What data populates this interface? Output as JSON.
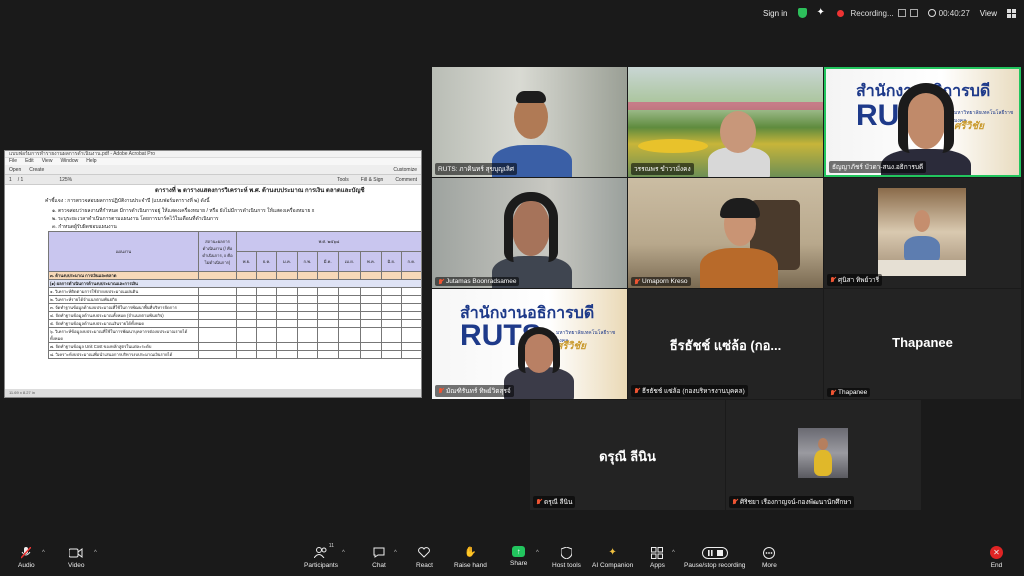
{
  "topbar": {
    "sign_in": "Sign in",
    "recording": "Recording...",
    "timer": "00:40:27",
    "view": "View"
  },
  "share": {
    "window_title": "แบบฟอร์มการทำรายงานผลการดำเนินงาน.pdf - Adobe Acrobat Pro",
    "menu": [
      "File",
      "Edit",
      "View",
      "Window",
      "Help"
    ],
    "toolbar1": [
      "Open",
      "Create"
    ],
    "customize": "Customize",
    "page_current": "1",
    "page_total": "/ 1",
    "zoom": "125%",
    "right_tabs": [
      "Tools",
      "Fill & Sign",
      "Comment"
    ],
    "heading": "ตารางที่ ๒ ตารางแสดงการวิเคราะห์ พ.ศ. ด้านงบประมาณ การเงิน ตลาดและบัญชี",
    "instructions": [
      "คำชี้แจง : การตรวจสอบผลการปฏิบัติงานประจำปี (แบบฟอร์มตารางที่ ๒) ดังนี้",
      "๑. ตรวจสอบว่าผลงานที่กำหนด มีการดำเนินการอยู่ ให้แสดงเครื่องหมาย / หรือ ยังไม่มีการดำเนินการ ให้แสดงเครื่องหมาย x",
      "๒. ระบุระยะเวลาดำเนินการตามแผนงาน โดยการมาร์คไว้ในเดือนที่ดำเนินการ",
      "๓. กำหนดผู้รับผิดชอบแผนงาน"
    ],
    "table": {
      "col_item": "แผนงาน",
      "col_status": "สถานะผลการดำเนินงาน (/ คือ ดำเนินการ, x คือ ไม่ดำเนินการ)",
      "col_year": "พ.ศ. ๒๕๖๘",
      "months": [
        "พ.ย.",
        "ธ.ค.",
        "ม.ค.",
        "ก.พ.",
        "มี.ค.",
        "เม.ย.",
        "พ.ค.",
        "มิ.ย.",
        "ก.ค."
      ],
      "section": "๓. ด้านงบประมาณ การเงินและตลาด",
      "subsection": "(๑) ผลการดำเนินการด้านงบประมาณและการเงิน",
      "rows": [
        "๑. วิเคราะห์ติดตามการใช้จ่ายงบประมาณแผ่นดิน",
        "๒. วิเคราะห์รายได้จำแนกตามพันธกิจ",
        "๓. จัดทำฐานข้อมูลด้านงบประมาณที่ใช้ในการพัฒนาพื้นที่บริหารจัดการ",
        "๔. จัดทำฐานข้อมูลด้านงบประมาณทั้งหมด (จำแนกตามพันธกิจ)",
        "๕. จัดทำฐานข้อมูลด้านงบประมาณเงินรายได้ทั้งหมด",
        "๖. วิเคราะห์ข้อมูลงบประมาณที่ใช้ในการพัฒนาบุคลากรต่องบประมาณรายได้ทั้งหมด",
        "๗. จัดทำฐานข้อมูล Unit Cost ของหลักสูตรในแต่ละระดับ",
        "๘. วิเคราะห์งบประมาณเพื่อนำเสนอการบริหารงบประมาณเงินรายได้"
      ]
    },
    "status": "11.69 x 8.27 in"
  },
  "participants": [
    {
      "name": "RUTS: ภาคินทร์ สุขบุญเลิศ",
      "muted": false
    },
    {
      "name": "วรรณพร ขำวามั่งคง",
      "muted": false
    },
    {
      "name": "ธัญญาภัชร์ บัวดา-สนง.อธิการบดี",
      "muted": false
    },
    {
      "name": "Jutamas Boonradsamee",
      "muted": true
    },
    {
      "name": "Umaporn Kreso",
      "muted": true
    },
    {
      "name": "ศุนิสา ทิพย์วารี",
      "muted": true
    },
    {
      "name": "มัณฑิรันทร์ ทิพย์วิตสุรจ์",
      "muted": true
    },
    {
      "name": "ธีรธัชช์ แซ่ล้อ (กองบริหารงานบุคคล)",
      "muted": true,
      "big": "ธีรธัชช์ แซ่ล้อ (กอ..."
    },
    {
      "name": "Thapanee",
      "muted": true,
      "big": "Thapanee"
    },
    {
      "name": "ดรุณี ลีนิน",
      "muted": true,
      "big": "ดรุณี ลีนิน"
    },
    {
      "name": "ศิริชยา เรืองกาญจน์-กองพัฒนานักศึกษา",
      "muted": true
    }
  ],
  "logo": {
    "thai_title": "สำนักงานอธิการบดี",
    "letters": "RUTS",
    "university": "มหาวิทยาลัยเทคโนโลยีราชมงคล",
    "campus": "ศรีวิชัย"
  },
  "toolbar": {
    "audio": "Audio",
    "video": "Video",
    "participants": "Participants",
    "participant_count": "11",
    "chat": "Chat",
    "react": "React",
    "raise_hand": "Raise hand",
    "share": "Share",
    "host_tools": "Host tools",
    "ai_companion": "AI Companion",
    "apps": "Apps",
    "pause_stop": "Pause/stop recording",
    "more": "More",
    "end": "End"
  },
  "colors": {
    "active_speaker": "#22c55e",
    "end_button": "#e02424",
    "share_button": "#22c55e",
    "mute_red": "#e53333"
  }
}
